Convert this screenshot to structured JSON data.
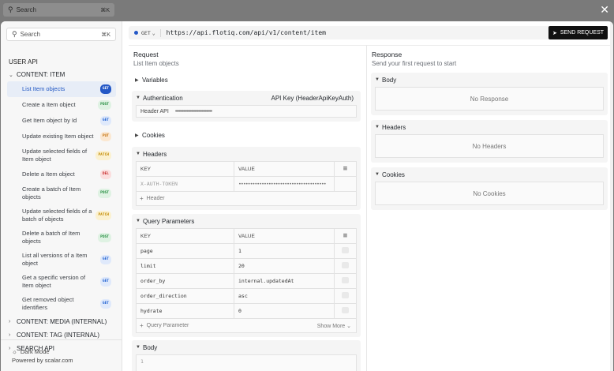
{
  "background": {
    "search_placeholder": "Search",
    "search_shortcut": "⌘K",
    "close_label": "✕"
  },
  "sidebar": {
    "search_placeholder": "Search",
    "search_shortcut": "⌘K",
    "section_title": "USER API",
    "groups": [
      {
        "label": "CONTENT: ITEM",
        "expanded": true
      },
      {
        "label": "CONTENT: MEDIA (INTERNAL)",
        "expanded": false
      },
      {
        "label": "CONTENT: TAG (INTERNAL)",
        "expanded": false
      },
      {
        "label": "SEARCH API",
        "expanded": false
      }
    ],
    "items": [
      {
        "label": "List Item objects",
        "method": "GET"
      },
      {
        "label": "Create a Item object",
        "method": "POST"
      },
      {
        "label": "Get Item object by Id",
        "method": "GET"
      },
      {
        "label": "Update existing Item object",
        "method": "PUT"
      },
      {
        "label": "Update selected fields of Item object",
        "method": "PATCH"
      },
      {
        "label": "Delete a Item object",
        "method": "DEL"
      },
      {
        "label": "Create a batch of Item objects",
        "method": "POST"
      },
      {
        "label": "Update selected fields of a batch of objects",
        "method": "PATCH"
      },
      {
        "label": "Delete a batch of Item objects",
        "method": "POST"
      },
      {
        "label": "List all versions of a Item object",
        "method": "GET"
      },
      {
        "label": "Get a specific version of Item object",
        "method": "GET"
      },
      {
        "label": "Get removed object identifiers",
        "method": "GET"
      }
    ],
    "dark_mode_label": "Dark Mode",
    "powered_by": "Powered by scalar.com"
  },
  "urlbar": {
    "method": "GET",
    "url": "https://api.flotiq.com/api/v1/content/item",
    "send_label": "SEND REQUEST"
  },
  "request": {
    "title": "Request",
    "subtitle": "List Item objects",
    "variables_label": "Variables",
    "auth": {
      "label": "Authentication",
      "scheme": "API Key (HeaderApiKeyAuth)",
      "field_label": "Header API",
      "field_value": "••••••••••••••••••••••••••••••••"
    },
    "cookies_label": "Cookies",
    "headers": {
      "label": "Headers",
      "col_key": "KEY",
      "col_value": "VALUE",
      "rows": [
        {
          "key": "X-AUTH-TOKEN",
          "value": "••••••••••••••••••••••••••••••••••••••"
        }
      ],
      "add_label": "Header"
    },
    "query": {
      "label": "Query Parameters",
      "col_key": "KEY",
      "col_value": "VALUE",
      "rows": [
        {
          "key": "page",
          "value": "1"
        },
        {
          "key": "limit",
          "value": "20"
        },
        {
          "key": "order_by",
          "value": "internal.updatedAt"
        },
        {
          "key": "order_direction",
          "value": "asc"
        },
        {
          "key": "hydrate",
          "value": "0"
        }
      ],
      "add_label": "Query Parameter",
      "show_more": "Show More"
    },
    "body": {
      "label": "Body",
      "line_number": "1"
    }
  },
  "response": {
    "title": "Response",
    "subtitle": "Send your first request to start",
    "body_label": "Body",
    "body_empty": "No Response",
    "headers_label": "Headers",
    "headers_empty": "No Headers",
    "cookies_label": "Cookies",
    "cookies_empty": "No Cookies"
  },
  "colors": {
    "accent": "#2458c6",
    "send_button": "#111111"
  }
}
